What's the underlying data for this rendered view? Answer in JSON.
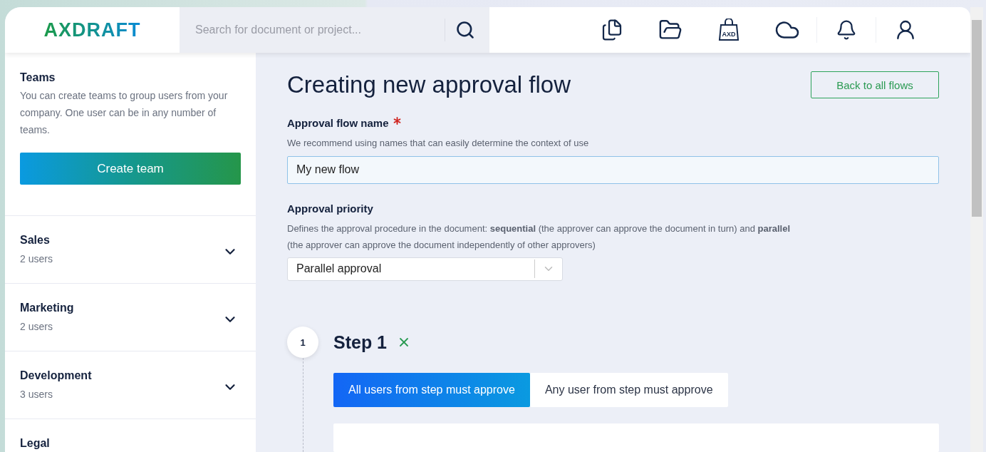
{
  "header": {
    "logo": "AXDRAFT",
    "bag_label": "AXD",
    "search": {
      "placeholder": "Search for document or project..."
    }
  },
  "sidebar": {
    "title": "Teams",
    "description": "You can create teams to group users from your company. One user can be in any number of teams.",
    "create_button": "Create team",
    "teams": [
      {
        "name": "Sales",
        "count": "2 users",
        "expanded": false
      },
      {
        "name": "Marketing",
        "count": "2 users",
        "expanded": false
      },
      {
        "name": "Development",
        "count": "3 users",
        "expanded": false
      },
      {
        "name": "Legal"
      }
    ]
  },
  "main": {
    "title": "Creating new approval flow",
    "back_button": "Back to all flows",
    "flow_name": {
      "label": "Approval flow name",
      "required": true,
      "hint": "We recommend using names that can easily determine the context of use",
      "value": "My new flow"
    },
    "priority": {
      "label": "Approval priority",
      "hint": "Defines the approval procedure in the document: **sequential** (the approver can approve the document in turn) and **parallel**",
      "hint_2": "(the approver can approve the document independently of other approvers)",
      "value": "Parallel approval"
    },
    "steps": [
      {
        "number": "1",
        "title": "Step 1",
        "options": [
          {
            "label": "All users from step must approve",
            "selected": true
          },
          {
            "label": "Any user from step must approve",
            "selected": false
          }
        ]
      }
    ]
  }
}
